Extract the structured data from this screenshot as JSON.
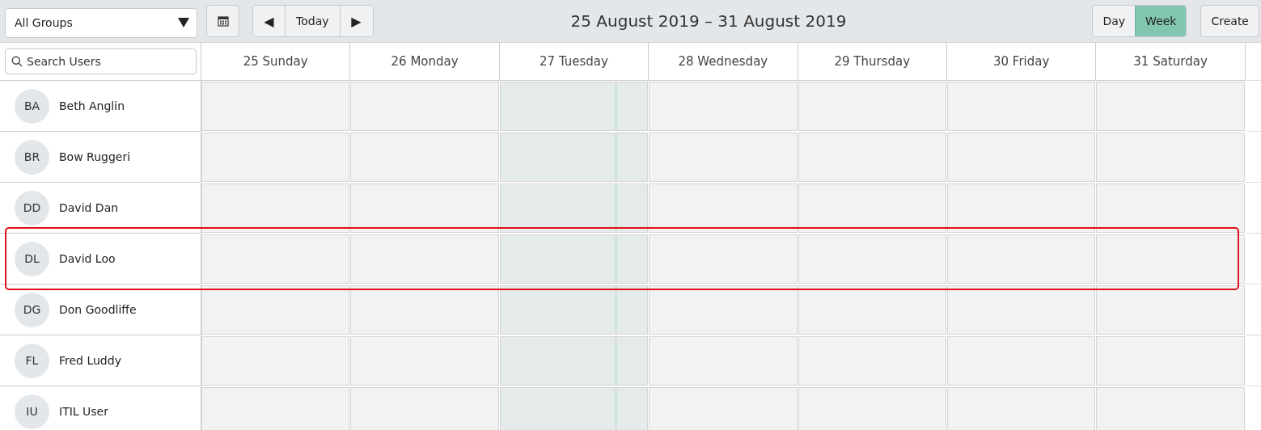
{
  "toolbar": {
    "group_select": "All Groups",
    "today_button": "Today",
    "prev_icon": "◀",
    "next_icon": "▶",
    "range_title": "25 August 2019 – 31 August 2019",
    "views": [
      {
        "label": "Day",
        "selected": false
      },
      {
        "label": "Week",
        "selected": true
      }
    ],
    "create_button": "Create"
  },
  "search": {
    "placeholder": "Search Users"
  },
  "days": [
    {
      "label": "25 Sunday",
      "today": false
    },
    {
      "label": "26 Monday",
      "today": false
    },
    {
      "label": "27 Tuesday",
      "today": true
    },
    {
      "label": "28 Wednesday",
      "today": false
    },
    {
      "label": "29 Thursday",
      "today": false
    },
    {
      "label": "30 Friday",
      "today": false
    },
    {
      "label": "31 Saturday",
      "today": false
    }
  ],
  "users": [
    {
      "initials": "BA",
      "name": "Beth Anglin",
      "highlighted": false
    },
    {
      "initials": "BR",
      "name": "Bow Ruggeri",
      "highlighted": false
    },
    {
      "initials": "DD",
      "name": "David Dan",
      "highlighted": false
    },
    {
      "initials": "DL",
      "name": "David Loo",
      "highlighted": true
    },
    {
      "initials": "DG",
      "name": "Don Goodliffe",
      "highlighted": false
    },
    {
      "initials": "FL",
      "name": "Fred Luddy",
      "highlighted": false
    },
    {
      "initials": "IU",
      "name": "ITIL User",
      "highlighted": false
    }
  ]
}
